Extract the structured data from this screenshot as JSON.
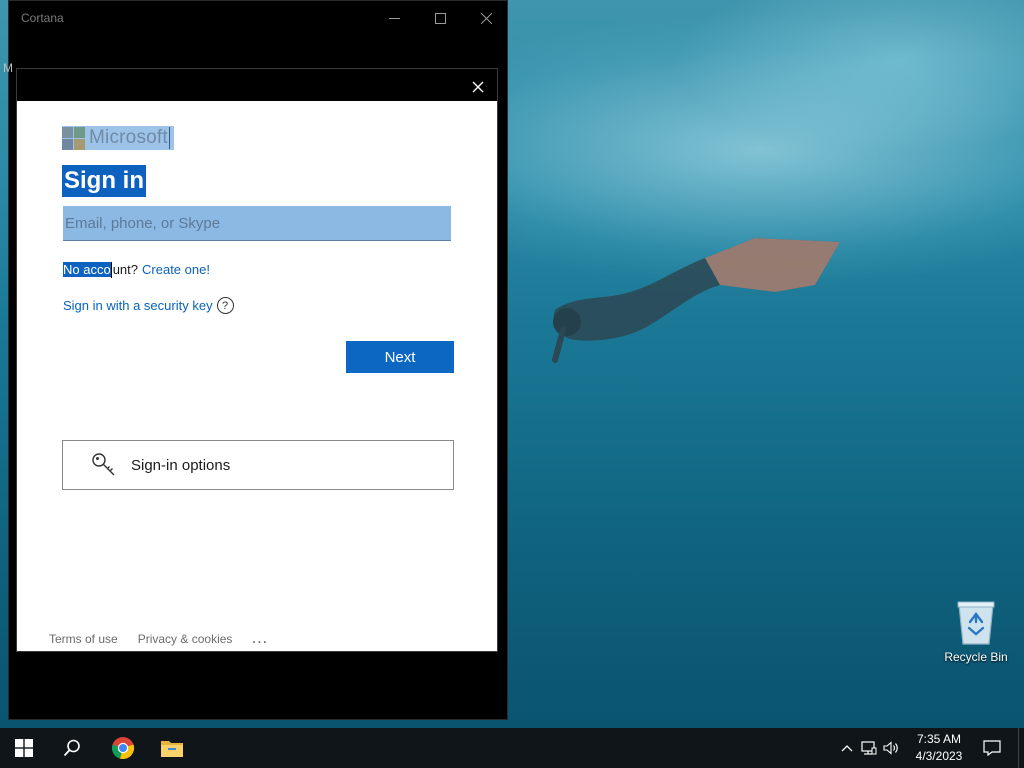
{
  "desktop": {
    "recycle_bin_label": "Recycle Bin"
  },
  "cortana_window": {
    "title": "Cortana",
    "side_char": "M"
  },
  "signin": {
    "logo_text": "Microsoft",
    "heading": "Sign in",
    "email_placeholder": "Email, phone, or Skype",
    "no_account_selected": "No acco",
    "no_account_rest": "unt?",
    "create_link": "Create one!",
    "security_key_link": "Sign in with a security key",
    "help_glyph": "?",
    "next_label": "Next",
    "options_label": "Sign-in options",
    "footer": {
      "terms": "Terms of use",
      "privacy": "Privacy & cookies",
      "more": "..."
    },
    "colors": {
      "accent": "#0b67c2",
      "link": "#0a62b8"
    }
  },
  "taskbar": {
    "time": "7:35 AM",
    "date": "4/3/2023",
    "icons": [
      "windows-start-icon",
      "search-icon",
      "chrome-icon",
      "file-explorer-icon"
    ],
    "tray_icons": [
      "chevron-up-icon",
      "network-icon",
      "volume-icon",
      "action-center-icon"
    ]
  }
}
